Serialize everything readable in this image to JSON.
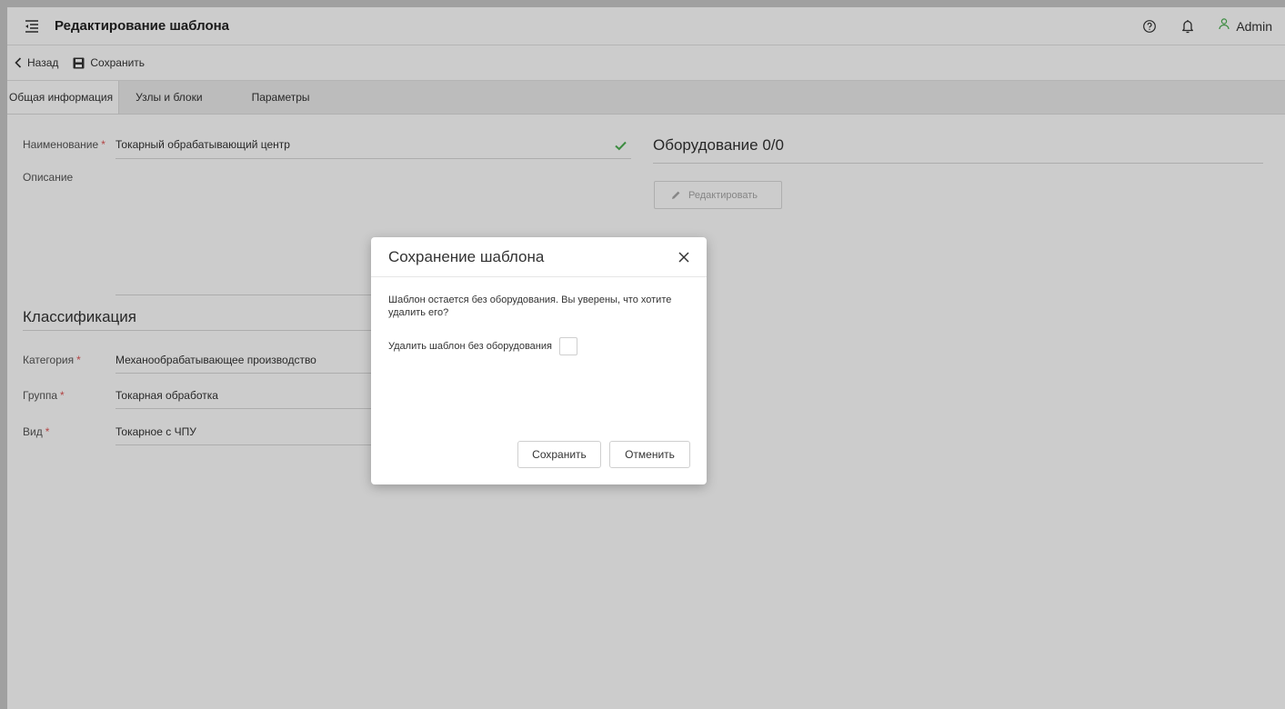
{
  "header": {
    "title": "Редактирование шаблона",
    "user_name": "Admin",
    "icons": {
      "menu": "menu-collapse-icon",
      "help": "help-icon",
      "notifications": "bell-icon",
      "user": "user-icon"
    }
  },
  "toolbar": {
    "back_label": "Назад",
    "save_label": "Сохранить"
  },
  "tabs": [
    {
      "label": "Общая информация",
      "active": true
    },
    {
      "label": "Узлы и блоки",
      "active": false
    },
    {
      "label": "Параметры",
      "active": false
    }
  ],
  "form": {
    "name_label": "Наименование",
    "name_value": "Токарный обрабатывающий центр",
    "description_label": "Описание",
    "required_mark": "*"
  },
  "classification": {
    "title": "Классификация",
    "category_label": "Категория",
    "category_value": "Механообрабатывающее производство",
    "group_label": "Группа",
    "group_value": "Токарная обработка",
    "type_label": "Вид",
    "type_value": "Токарное с ЧПУ"
  },
  "equipment": {
    "title": "Оборудование 0/0",
    "edit_label": "Редактировать"
  },
  "dialog": {
    "title": "Сохранение шаблона",
    "message": "Шаблон остается без оборудования. Вы уверены, что хотите удалить его?",
    "checkbox_label": "Удалить шаблон без оборудования",
    "checkbox_checked": false,
    "save_label": "Сохранить",
    "cancel_label": "Отменить"
  },
  "colors": {
    "accent_green": "#4caf50",
    "required_red": "#e05555"
  }
}
